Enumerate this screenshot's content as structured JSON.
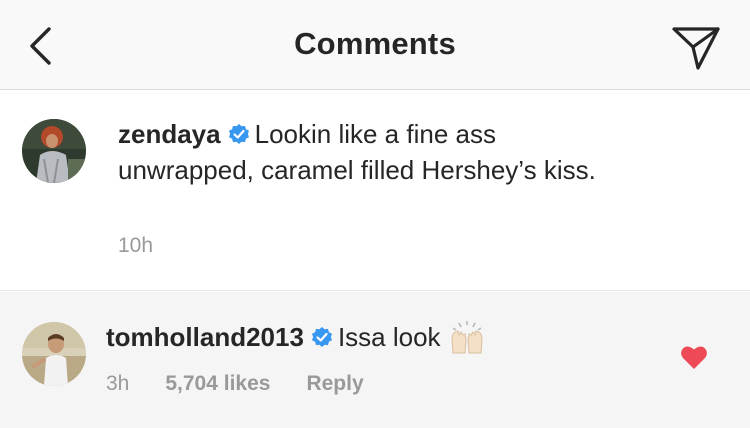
{
  "header": {
    "title": "Comments",
    "back_icon": "chevron-left-icon",
    "share_icon": "paper-plane-icon"
  },
  "caption": {
    "username": "zendaya",
    "verified": true,
    "text": "Lookin like a fine ass unwrapped, caramel filled Hershey’s kiss.",
    "time": "10h"
  },
  "reply": {
    "username": "tomholland2013",
    "verified": true,
    "text": "Issa look",
    "emoji": "raising-hands",
    "time": "3h",
    "likes": "5,704 likes",
    "reply_label": "Reply",
    "liked": true
  },
  "colors": {
    "verified_blue": "#3897f0",
    "like_red": "#ed4956",
    "meta_gray": "#999999",
    "text": "#262626"
  }
}
